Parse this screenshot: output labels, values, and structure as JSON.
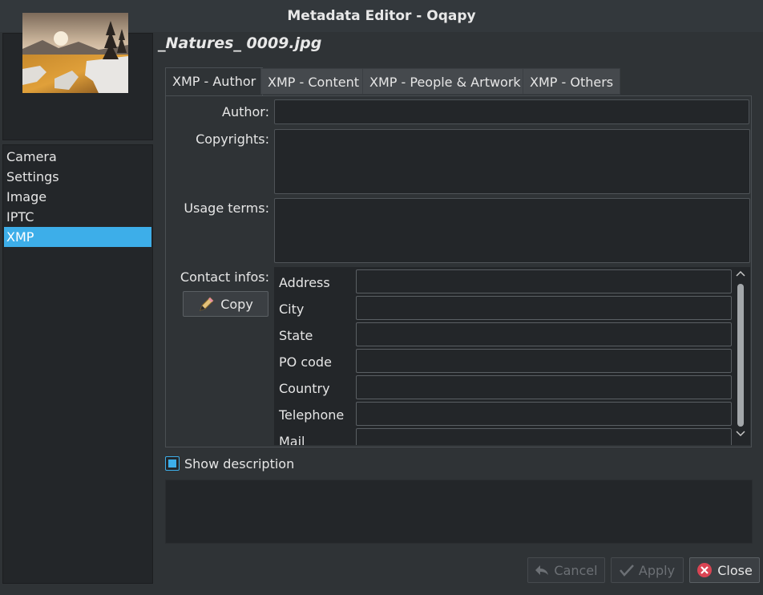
{
  "window": {
    "title": "Metadata Editor - Oqapy"
  },
  "file": {
    "name": "_Natures_ 0009.jpg"
  },
  "sidebar": {
    "items": [
      {
        "label": "Camera"
      },
      {
        "label": "Settings"
      },
      {
        "label": "Image"
      },
      {
        "label": "IPTC"
      },
      {
        "label": "XMP"
      }
    ],
    "selected": "XMP"
  },
  "tabs": [
    {
      "label": "XMP - Author"
    },
    {
      "label": "XMP - Content"
    },
    {
      "label": "XMP - People & Artwork"
    },
    {
      "label": "XMP - Others"
    }
  ],
  "author_tab": {
    "author_label": "Author:",
    "author_value": "",
    "copyrights_label": "Copyrights:",
    "copyrights_value": "",
    "usage_label": "Usage terms:",
    "usage_value": "",
    "contact_label": "Contact infos:",
    "copy_button": "Copy",
    "contact_fields": [
      {
        "label": "Address",
        "value": ""
      },
      {
        "label": "City",
        "value": ""
      },
      {
        "label": "State",
        "value": ""
      },
      {
        "label": "PO code",
        "value": ""
      },
      {
        "label": "Country",
        "value": ""
      },
      {
        "label": "Telephone",
        "value": ""
      },
      {
        "label": "Mail",
        "value": ""
      }
    ]
  },
  "description": {
    "checkbox_label": "Show description",
    "checked": true,
    "value": ""
  },
  "buttons": {
    "cancel": "Cancel",
    "apply": "Apply",
    "close": "Close"
  },
  "icons": {
    "copy": "pencil-icon",
    "cancel": "undo-arrow-icon",
    "apply": "checkmark-icon",
    "close": "close-circle-icon"
  },
  "colors": {
    "accent": "#3daee9",
    "close_icon": "#da4453",
    "background": "#2f3336",
    "field": "#232629"
  }
}
